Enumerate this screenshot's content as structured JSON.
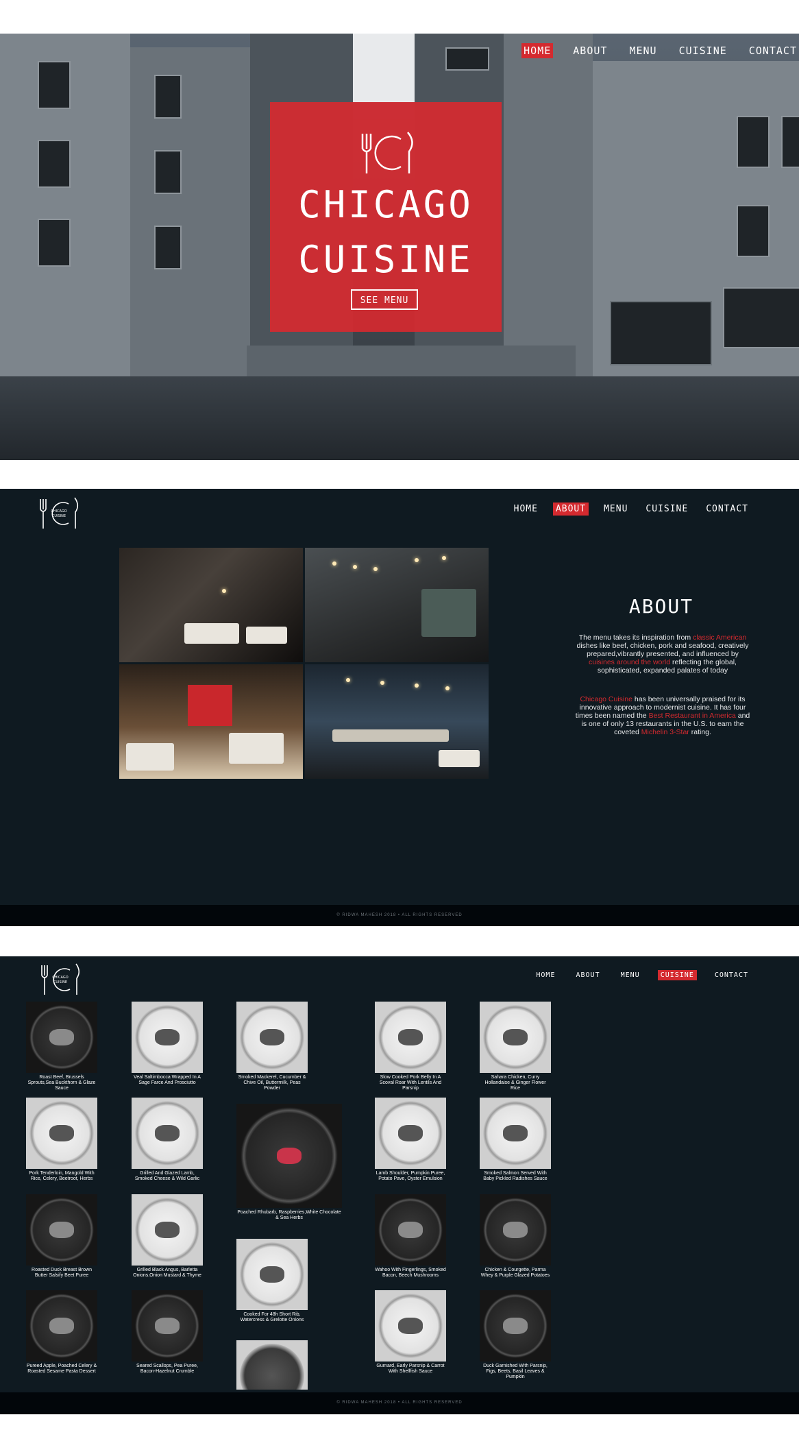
{
  "hero": {
    "nav": [
      {
        "label": "HOME",
        "active": true
      },
      {
        "label": "ABOUT",
        "active": false
      },
      {
        "label": "MENU",
        "active": false
      },
      {
        "label": "CUISINE",
        "active": false
      },
      {
        "label": "CONTACT",
        "active": false
      }
    ],
    "title_line1": "CHICAGO",
    "title_line2": "CUISINE",
    "cta": "SEE MENU"
  },
  "about": {
    "logo_text": "CHICAGO CUISINE",
    "nav": [
      {
        "label": "HOME",
        "active": false
      },
      {
        "label": "ABOUT",
        "active": true
      },
      {
        "label": "MENU",
        "active": false
      },
      {
        "label": "CUISINE",
        "active": false
      },
      {
        "label": "CONTACT",
        "active": false
      }
    ],
    "heading": "ABOUT",
    "p1": {
      "a": "The menu takes its inspiration from ",
      "b": "classic American",
      "c": " dishes like beef, chicken, pork and seafood, creatively prepared,vibrantly presented, and influenced by ",
      "d": "cuisines around the world",
      "e": " reflecting the global, sophisticated, expanded palates of today"
    },
    "p2": {
      "a": "Chicago Cuisine",
      "b": " has been universally praised for its innovative approach to modernist cuisine. It has four times been named the ",
      "c": "Best Restaurant in America",
      "d": " and is one of only 13 restaurants in the U.S. to earn the coveted ",
      "e": "Michelin 3-Star",
      "f": " rating."
    },
    "footer": "© RIDWA MAHESH 2018 • ALL RIGHTS RESERVED"
  },
  "cuisine": {
    "logo_text": "CHICAGO CUISINE",
    "nav": [
      {
        "label": "HOME",
        "active": false
      },
      {
        "label": "ABOUT",
        "active": false
      },
      {
        "label": "MENU",
        "active": false
      },
      {
        "label": "CUISINE",
        "active": true
      },
      {
        "label": "CONTACT",
        "active": false
      }
    ],
    "dishes": [
      "Roast Beef, Brussels Sprouts,Sea Buckthorn & Glaze Sauce",
      "Veal Saltimbocca Wrapped In A Sage Farce And Prosciutto",
      "Smoked Mackerel, Cucumber & Chive Oil, Buttermilk, Peas Powder",
      "Slow Cooked Pork Belly In A Scoval Roar With Lentils And Parsnip",
      "Sahara Chicken, Curry Hollandaise & Ginger Flower Rice",
      "Pork Tenderloin, Mangold With Rice, Celery, Beetroot, Herbs",
      "Grilled And Glazed Lamb, Smoked Cheese & Wild Garlic",
      "Poached Rhubarb, Raspberries,White Chocolate & Sea Herbs",
      "Lamb Shoulder, Pumpkin Puree, Potato Pave, Oyster Emulsion",
      "Smoked Salmon Served With Baby Pickled Radishes Sauce",
      "Roasted Duck Breast Brown Butter Salsify Beet Puree",
      "Grilled Black Angus, Barletta Onions,Onion Mustard & Thyme",
      "Cooked For 48h Short Rib, Watercress & Grelotte Onions",
      "Wahoo With Fingerlings, Smoked Bacon, Beech Mushrooms",
      "Chicken & Courgette, Parma Whey & Purple Glazed Potatoes",
      "Pureed Apple, Poached Celery & Roasted Sesame Pasta Dessert",
      "Seared Scallops, Pea Puree, Bacon-Hazelnut Crumble",
      "Gurnard, Early Parsnip & Carrot With Shellfish Sauce",
      "Duck Garnished With Parsnip, Figs, Beets, Basil Leaves & Pumpkin"
    ],
    "footer": "© RIDWA MAHESH 2018 • ALL RIGHTS RESERVED"
  },
  "colors": {
    "accent": "#d42a2f",
    "background": "#0f1a21",
    "footer": "#02060a"
  },
  "icons": [
    "fork-icon",
    "knife-icon",
    "cuisine-c-logo"
  ]
}
